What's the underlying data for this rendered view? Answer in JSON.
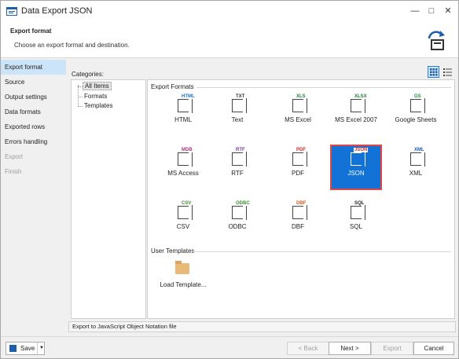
{
  "window": {
    "title": "Data Export JSON"
  },
  "header": {
    "title": "Export format",
    "subtitle": "Choose an export format and destination."
  },
  "nav": [
    {
      "label": "Export format",
      "state": "active"
    },
    {
      "label": "Source",
      "state": "normal"
    },
    {
      "label": "Output settings",
      "state": "normal"
    },
    {
      "label": "Data formats",
      "state": "normal"
    },
    {
      "label": "Exported rows",
      "state": "normal"
    },
    {
      "label": "Errors handling",
      "state": "normal"
    },
    {
      "label": "Export",
      "state": "disabled"
    },
    {
      "label": "Finish",
      "state": "disabled"
    }
  ],
  "categories": {
    "label": "Categories:",
    "items": [
      "All Items",
      "Formats",
      "Templates"
    ],
    "selected": "All Items"
  },
  "formats": {
    "group_title": "Export Formats",
    "items": [
      {
        "label": "HTML",
        "tag": "HTML",
        "color": "#1a73c7"
      },
      {
        "label": "Text",
        "tag": "TXT",
        "color": "#333333"
      },
      {
        "label": "MS Excel",
        "tag": "XLS",
        "color": "#1e7b3a"
      },
      {
        "label": "MS Excel 2007",
        "tag": "XLSX",
        "color": "#1e7b3a"
      },
      {
        "label": "Google Sheets",
        "tag": "GS",
        "color": "#1e8e3e"
      },
      {
        "label": "MS Access",
        "tag": "MDB",
        "color": "#a4377a"
      },
      {
        "label": "RTF",
        "tag": "RTF",
        "color": "#7d3c98"
      },
      {
        "label": "PDF",
        "tag": "PDF",
        "color": "#d12b2b"
      },
      {
        "label": "JSON",
        "tag": "JSON",
        "color": "#d12b2b",
        "selected": true
      },
      {
        "label": "XML",
        "tag": "XML",
        "color": "#1a5bb0"
      },
      {
        "label": "CSV",
        "tag": "CSV",
        "color": "#3c8a2e"
      },
      {
        "label": "ODBC",
        "tag": "ODBC",
        "color": "#3c8a2e"
      },
      {
        "label": "DBF",
        "tag": "DBF",
        "color": "#d15b1f"
      },
      {
        "label": "SQL",
        "tag": "SQL",
        "color": "#222222"
      }
    ]
  },
  "templates": {
    "group_title": "User Templates",
    "load_label": "Load Template..."
  },
  "status_text": "Export to JavaScript Object Notation file",
  "footer": {
    "save_label": "Save",
    "back_label": "< Back",
    "next_label": "Next >",
    "export_label": "Export",
    "cancel_label": "Cancel"
  },
  "colors": {
    "accent": "#1272d6",
    "selection_border": "#e04848",
    "nav_active": "#cce4f7"
  }
}
